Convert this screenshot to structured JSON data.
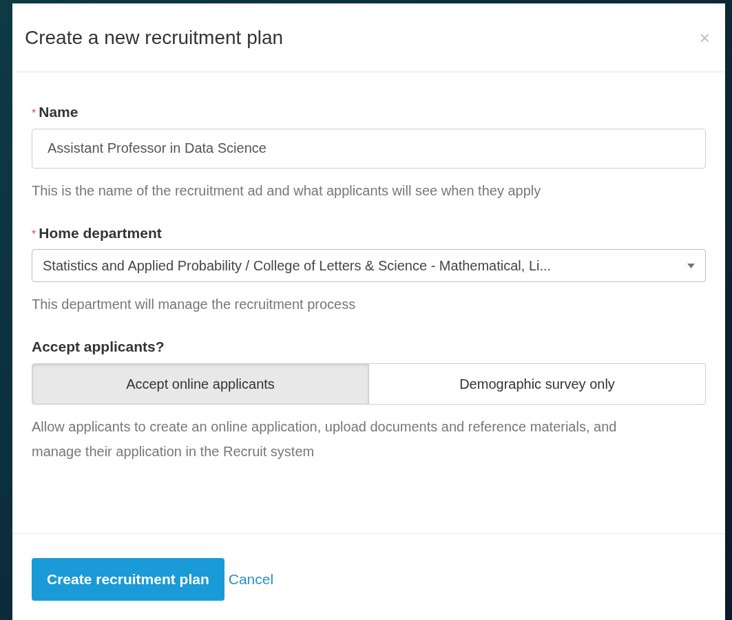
{
  "dialog": {
    "title": "Create a new recruitment plan",
    "close": "×"
  },
  "fields": [
    {
      "kind": "text",
      "label": "Name",
      "marker": "*",
      "value": "Assistant Professor in Data Science",
      "help": "This is the name of the recruitment ad and what applicants will see when they apply"
    },
    {
      "kind": "select",
      "label": "Home department",
      "marker": "*",
      "value": "Statistics and Applied Probability / College of Letters & Science - Mathematical, Li...",
      "help": "This department will manage the recruitment process"
    },
    {
      "kind": "toggle",
      "label": "Accept applicants?",
      "options": [
        {
          "label": "Accept online applicants",
          "selected": true
        },
        {
          "label": "Demographic survey only",
          "selected": false
        }
      ],
      "help": "Allow applicants to create an online application, upload documents and reference materials, and manage their application in the Recruit system"
    }
  ],
  "footer": {
    "primary": "Create recruitment plan",
    "secondary": "Cancel"
  }
}
